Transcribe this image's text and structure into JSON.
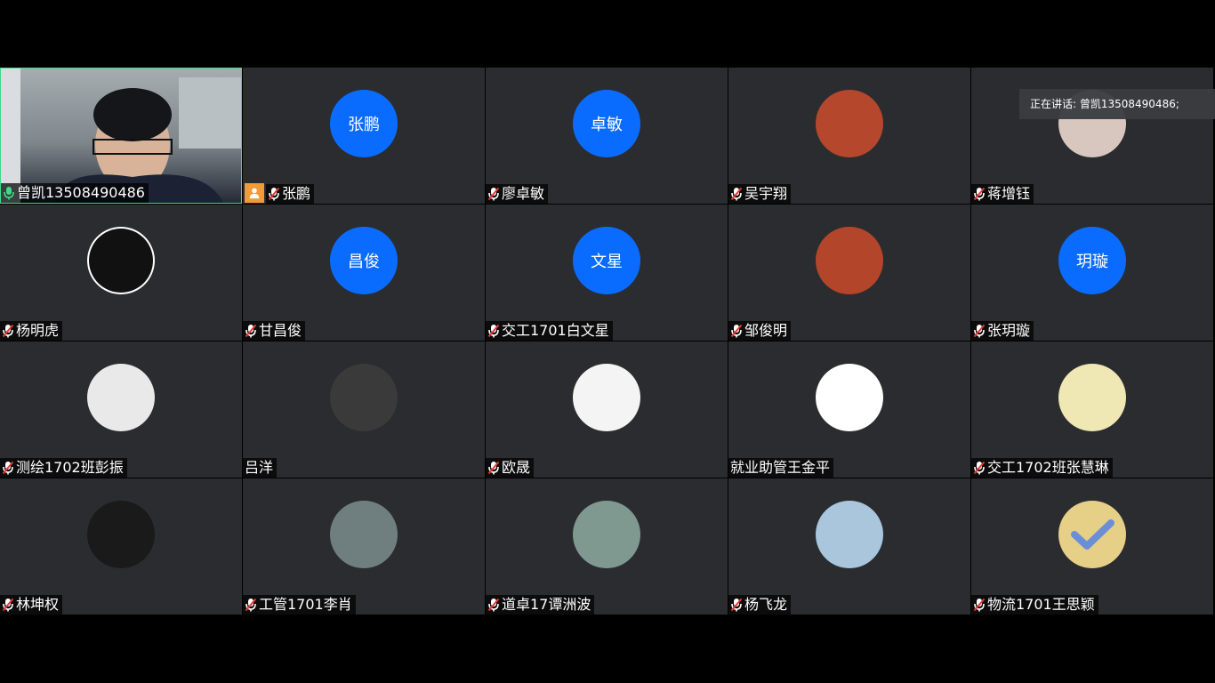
{
  "speaking_banner": "正在讲话: 曾凯13508490486;",
  "participants": [
    {
      "name": "曾凯13508490486",
      "type": "video",
      "mic": "on",
      "active": true
    },
    {
      "name": "张鹏",
      "avatar_text": "张鹏",
      "type": "text",
      "mic": "muted",
      "host": true
    },
    {
      "name": "廖卓敏",
      "avatar_text": "卓敏",
      "type": "text",
      "mic": "muted"
    },
    {
      "name": "吴宇翔",
      "type": "photo",
      "mic": "muted",
      "photo_color": "#b5472d"
    },
    {
      "name": "蒋增钰",
      "type": "photo",
      "mic": "muted",
      "photo_color": "#d7c7be"
    },
    {
      "name": "杨明虎",
      "type": "photo",
      "mic": "muted",
      "photo_color": "#111111",
      "ring": true
    },
    {
      "name": "甘昌俊",
      "avatar_text": "昌俊",
      "type": "text",
      "mic": "muted"
    },
    {
      "name": "交工1701白文星",
      "avatar_text": "文星",
      "type": "text",
      "mic": "muted"
    },
    {
      "name": "邹俊明",
      "type": "photo",
      "mic": "muted",
      "photo_color": "#b3452a"
    },
    {
      "name": "张玥璇",
      "avatar_text": "玥璇",
      "type": "text",
      "mic": "muted"
    },
    {
      "name": "测绘1702班彭振",
      "type": "photo",
      "mic": "muted",
      "photo_color": "#e9e9e9"
    },
    {
      "name": "吕洋",
      "type": "photo",
      "mic": "none",
      "photo_color": "#3a3a3a"
    },
    {
      "name": "欧晟",
      "type": "photo",
      "mic": "muted",
      "photo_color": "#f4f4f4"
    },
    {
      "name": "就业助管王金平",
      "type": "photo",
      "mic": "none",
      "photo_color": "#ffffff"
    },
    {
      "name": "交工1702班张慧琳",
      "type": "photo",
      "mic": "muted",
      "photo_color": "#efe7b4"
    },
    {
      "name": "林坤权",
      "type": "photo",
      "mic": "muted",
      "photo_color": "#1a1a1a"
    },
    {
      "name": "工管1701李肖",
      "type": "photo",
      "mic": "muted",
      "photo_color": "#6f7f80"
    },
    {
      "name": "道卓17谭洲波",
      "type": "photo",
      "mic": "muted",
      "photo_color": "#7f9890"
    },
    {
      "name": "杨飞龙",
      "type": "photo",
      "mic": "muted",
      "photo_color": "#a9c6dd"
    },
    {
      "name": "物流1701王思颖",
      "type": "photo",
      "mic": "muted",
      "photo_color": "#e6cf86",
      "check": true
    }
  ]
}
